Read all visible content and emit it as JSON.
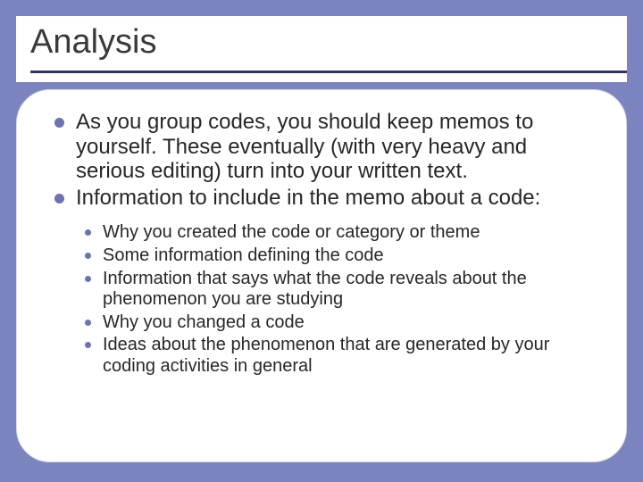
{
  "slide": {
    "title": "Analysis",
    "bullets": [
      "As you group codes, you should keep memos to yourself.  These eventually (with very heavy and serious editing) turn into your written text.",
      "Information to include in the memo about a code:"
    ],
    "sub_bullets": [
      "Why you created the code or category or theme",
      "Some information defining the code",
      "Information that says what the code reveals about the phenomenon you are studying",
      "Why you changed a code",
      "Ideas about the phenomenon that are generated by your coding activities in general"
    ]
  }
}
